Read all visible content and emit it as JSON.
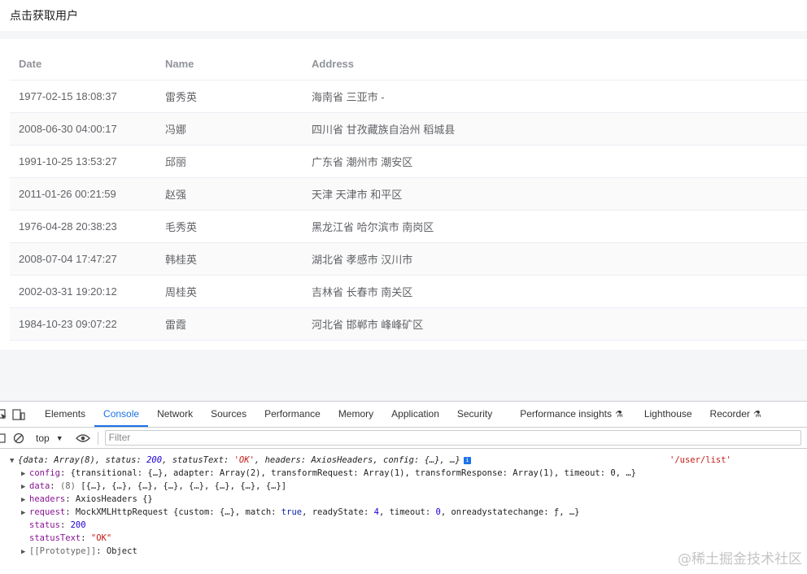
{
  "page": {
    "fetch_link": "点击获取用户"
  },
  "table": {
    "headers": [
      "Date",
      "Name",
      "Address"
    ],
    "rows": [
      {
        "date": "1977-02-15 18:08:37",
        "name": "雷秀英",
        "address": "海南省 三亚市 -"
      },
      {
        "date": "2008-06-30 04:00:17",
        "name": "冯娜",
        "address": "四川省 甘孜藏族自治州 稻城县"
      },
      {
        "date": "1991-10-25 13:53:27",
        "name": "邱丽",
        "address": "广东省 潮州市 潮安区"
      },
      {
        "date": "2011-01-26 00:21:59",
        "name": "赵强",
        "address": "天津 天津市 和平区"
      },
      {
        "date": "1976-04-28 20:38:23",
        "name": "毛秀英",
        "address": "黑龙江省 哈尔滨市 南岗区"
      },
      {
        "date": "2008-07-04 17:47:27",
        "name": "韩桂英",
        "address": "湖北省 孝感市 汉川市"
      },
      {
        "date": "2002-03-31 19:20:12",
        "name": "周桂英",
        "address": "吉林省 长春市 南关区"
      },
      {
        "date": "1984-10-23 09:07:22",
        "name": "雷霞",
        "address": "河北省 邯郸市 峰峰矿区"
      }
    ]
  },
  "devtools": {
    "tabs": [
      "Elements",
      "Console",
      "Network",
      "Sources",
      "Performance",
      "Memory",
      "Application",
      "Security",
      "Performance insights",
      "Lighthouse",
      "Recorder"
    ],
    "active_tab": "Console",
    "context": "top",
    "filter_placeholder": "Filter",
    "console": {
      "summary_open": "{",
      "summary_data_key": "data",
      "summary_data_val": "Array(8)",
      "summary_status_key": "status",
      "summary_status_val": "200",
      "summary_statustext_key": "statusText",
      "summary_statustext_val": "'OK'",
      "summary_headers_key": "headers",
      "summary_headers_val": "AxiosHeaders",
      "summary_config_key": "config",
      "summary_config_val": "{…}, …}",
      "source": "'/user/list'",
      "config_key": "config",
      "config_val": "{transitional: {…}, adapter: Array(2), transformRequest: Array(1), transformResponse: Array(1), timeout: 0, …}",
      "data_key": "data",
      "data_count": "(8)",
      "data_val": "[{…}, {…}, {…}, {…}, {…}, {…}, {…}, {…}]",
      "headers_key": "headers",
      "headers_val": "AxiosHeaders {}",
      "request_key": "request",
      "request_val_a": "MockXMLHttpRequest {custom: {…}, match: ",
      "request_val_true": "true",
      "request_val_b": ", readyState: ",
      "request_val_4": "4",
      "request_val_c": ", timeout: ",
      "request_val_0": "0",
      "request_val_d": ", onreadystatechange: ƒ, …}",
      "status_key": "status",
      "status_val": "200",
      "statustext_key": "statusText",
      "statustext_val": "\"OK\"",
      "prototype_key": "[[Prototype]]",
      "prototype_val": "Object"
    }
  },
  "watermark": "@稀土掘金技术社区"
}
